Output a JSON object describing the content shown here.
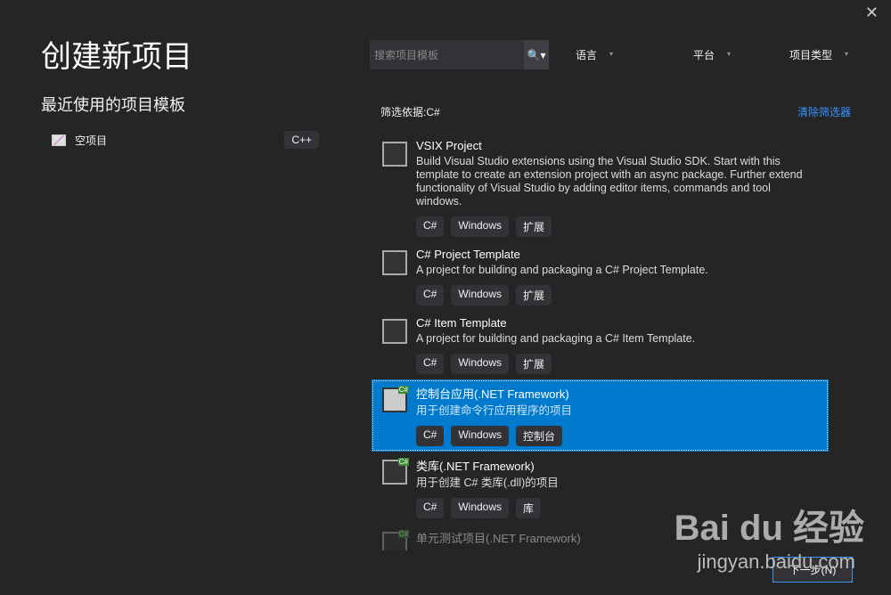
{
  "title": "创建新项目",
  "recent_heading": "最近使用的项目模板",
  "close": "✕",
  "recent": [
    {
      "name": "空项目",
      "tag": "C++"
    }
  ],
  "search": {
    "placeholder": "搜索项目模板",
    "icon": "🔍",
    "dropdown": "▾"
  },
  "filters": [
    {
      "label": "语言",
      "caret": "▾"
    },
    {
      "label": "平台",
      "caret": "▾"
    },
    {
      "label": "项目类型",
      "caret": "▾"
    }
  ],
  "filter_basis": "筛选依据:C#",
  "clear_filters": "清除筛选器",
  "templates": [
    {
      "name": "VSIX Project",
      "desc": "Build Visual Studio extensions using the Visual Studio SDK. Start with this template to create an extension project with an async package. Further extend functionality of Visual Studio by adding editor items, commands and tool windows.",
      "tags": [
        "C#",
        "Windows",
        "扩展"
      ]
    },
    {
      "name": "C# Project Template",
      "desc": "A project for building and packaging a C# Project Template.",
      "tags": [
        "C#",
        "Windows",
        "扩展"
      ]
    },
    {
      "name": "C# Item Template",
      "desc": "A project for building and packaging a C# Item Template.",
      "tags": [
        "C#",
        "Windows",
        "扩展"
      ]
    },
    {
      "name": "控制台应用(.NET Framework)",
      "desc": "用于创建命令行应用程序的项目",
      "tags": [
        "C#",
        "Windows",
        "控制台"
      ],
      "badge": "C#"
    },
    {
      "name": "类库(.NET Framework)",
      "desc": "用于创建 C# 类库(.dll)的项目",
      "tags": [
        "C#",
        "Windows",
        "库"
      ],
      "badge": "C#"
    },
    {
      "name": "单元测试项目(.NET Framework)",
      "badge": "C#"
    }
  ],
  "watermark": "Bai du 经验",
  "watermark_url": "jingyan.baidu.com",
  "next_button": "下一步(N)"
}
